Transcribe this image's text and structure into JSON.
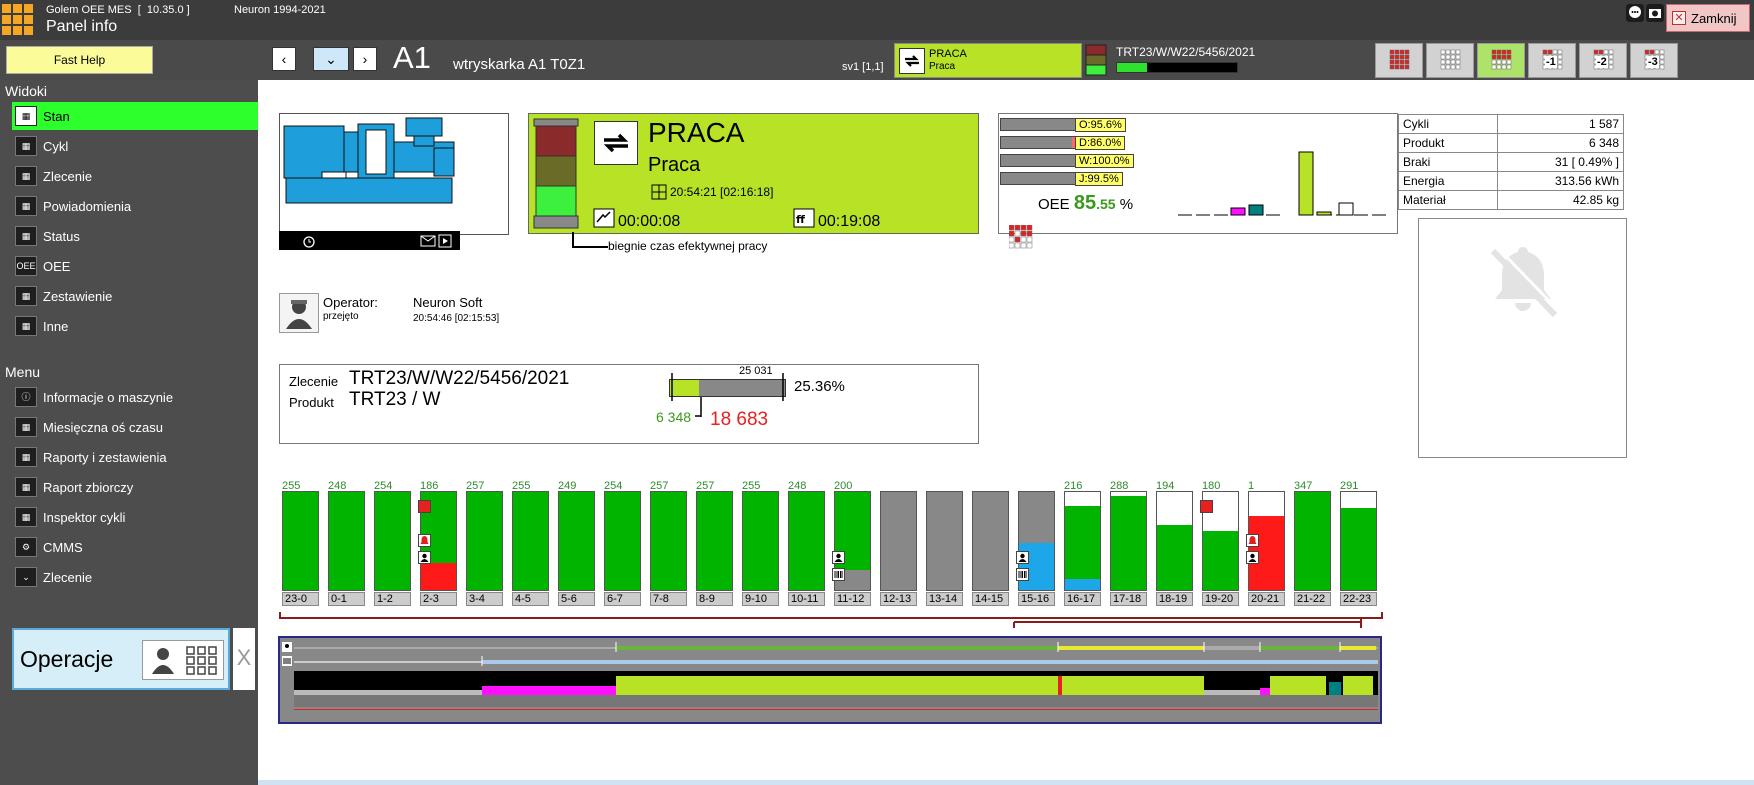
{
  "app": {
    "name": "Golem OEE MES  [  10.35.0 ]",
    "panel_title": "Panel info",
    "copyright": "Neuron 1994-2021",
    "close_label": "Zamknij"
  },
  "toolbar": {
    "fast_help": "Fast Help",
    "machine_id": "A1",
    "machine_desc": "wtryskarka A1  T0Z1",
    "sv": "sv1  [1,1]",
    "status_title": "PRACA",
    "status_sub": "Praca",
    "order_number": "TRT23/W/W22/5456/2021",
    "order_progress": 0.25,
    "view_buttons": [
      "",
      "",
      "",
      "-1",
      "-2",
      "-3"
    ]
  },
  "sidebar": {
    "views_header": "Widoki",
    "views": [
      {
        "label": "Stan",
        "icon": "machine-icon"
      },
      {
        "label": "Cykl",
        "icon": "cycle-icon"
      },
      {
        "label": "Zlecenie",
        "icon": "barcode-icon"
      },
      {
        "label": "Powiadomienia",
        "icon": "notification-icon"
      },
      {
        "label": "Status",
        "icon": "traffic-light-icon"
      },
      {
        "label": "OEE",
        "icon": "oee-icon"
      },
      {
        "label": "Zestawienie",
        "icon": "summary-icon"
      },
      {
        "label": "Inne",
        "icon": "flask-icon"
      }
    ],
    "menu_header": "Menu",
    "menu": [
      {
        "label": "Informacje o maszynie",
        "icon": "info-icon"
      },
      {
        "label": "Miesięczna oś czasu",
        "icon": "calendar-icon"
      },
      {
        "label": "Raporty i zestawienia",
        "icon": "report-icon"
      },
      {
        "label": "Raport zbiorczy",
        "icon": "summary-report-icon"
      },
      {
        "label": "Inspektor cykli",
        "icon": "inspector-icon"
      },
      {
        "label": "CMMS",
        "icon": "gear-icon"
      },
      {
        "label": "Zlecenie",
        "icon": "chevron-down-icon"
      }
    ],
    "operations_label": "Operacje",
    "operations_close": "X"
  },
  "status": {
    "title": "PRACA",
    "subtitle": "Praca",
    "time": "20:54:21   [02:16:18]",
    "run_time": "00:00:08",
    "stop_time": "00:19:08",
    "note": "biegnie czas efektywnej pracy"
  },
  "oee": {
    "bars": [
      {
        "label": "O:95.6%",
        "fraction": 0.956
      },
      {
        "label": "D:86.0%",
        "fraction": 0.86
      },
      {
        "label": "W:100.0%",
        "fraction": 1.0
      },
      {
        "label": "J:99.5%",
        "fraction": 0.995
      }
    ],
    "prefix": "OEE",
    "int": "85",
    "dec": ".55",
    "unit": "%"
  },
  "stats": [
    {
      "label": "Cykli",
      "value": "1 587"
    },
    {
      "label": "Produkt",
      "value": "6 348"
    },
    {
      "label": "Braki",
      "value": "31 [ 0.49% ]"
    },
    {
      "label": "Energia",
      "value": "313.56 kWh"
    },
    {
      "label": "Materiał",
      "value": "42.85 kg"
    }
  ],
  "operator": {
    "label": "Operator:",
    "sub": "przejęto",
    "name": "Neuron Soft",
    "time": "20:54:46  [02:15:53]"
  },
  "order": {
    "order_label": "Zlecenie",
    "product_label": "Produkt",
    "order_value": "TRT23/W/W22/5456/2021",
    "product_value": "TRT23 / W",
    "total": "25 031",
    "percent": "25.36%",
    "done": "6 348",
    "remaining": "18 683",
    "progress": 0.2536
  },
  "hours": [
    {
      "label": "23-0",
      "value": "255",
      "green": 1.0,
      "red": 0,
      "gray": 0,
      "blue": 0
    },
    {
      "label": "0-1",
      "value": "248",
      "green": 1.0,
      "red": 0,
      "gray": 0,
      "blue": 0
    },
    {
      "label": "1-2",
      "value": "254",
      "green": 1.0,
      "red": 0,
      "gray": 0,
      "blue": 0
    },
    {
      "label": "2-3",
      "value": "186",
      "green": 0.72,
      "red": 0.28,
      "gray": 0,
      "blue": 0
    },
    {
      "label": "3-4",
      "value": "257",
      "green": 1.0,
      "red": 0,
      "gray": 0,
      "blue": 0
    },
    {
      "label": "4-5",
      "value": "255",
      "green": 1.0,
      "red": 0,
      "gray": 0,
      "blue": 0
    },
    {
      "label": "5-6",
      "value": "249",
      "green": 1.0,
      "red": 0,
      "gray": 0,
      "blue": 0
    },
    {
      "label": "6-7",
      "value": "254",
      "green": 1.0,
      "red": 0,
      "gray": 0,
      "blue": 0
    },
    {
      "label": "7-8",
      "value": "257",
      "green": 1.0,
      "red": 0,
      "gray": 0,
      "blue": 0
    },
    {
      "label": "8-9",
      "value": "257",
      "green": 1.0,
      "red": 0,
      "gray": 0,
      "blue": 0
    },
    {
      "label": "9-10",
      "value": "255",
      "green": 1.0,
      "red": 0,
      "gray": 0,
      "blue": 0
    },
    {
      "label": "10-11",
      "value": "248",
      "green": 1.0,
      "red": 0,
      "gray": 0,
      "blue": 0
    },
    {
      "label": "11-12",
      "value": "200",
      "green": 0.8,
      "red": 0,
      "gray": 0.2,
      "blue": 0
    },
    {
      "label": "12-13",
      "value": "",
      "green": 0,
      "red": 0,
      "gray": 1.0,
      "blue": 0
    },
    {
      "label": "13-14",
      "value": "",
      "green": 0,
      "red": 0,
      "gray": 1.0,
      "blue": 0
    },
    {
      "label": "14-15",
      "value": "",
      "green": 0,
      "red": 0,
      "gray": 1.0,
      "blue": 0
    },
    {
      "label": "15-16",
      "value": "",
      "green": 0,
      "red": 0,
      "gray": 0.52,
      "blue": 0.48
    },
    {
      "label": "16-17",
      "value": "216",
      "green": 0.74,
      "red": 0,
      "gray": 0,
      "blue": 0.11
    },
    {
      "label": "17-18",
      "value": "288",
      "green": 0.96,
      "red": 0,
      "gray": 0,
      "blue": 0
    },
    {
      "label": "18-19",
      "value": "194",
      "green": 0.66,
      "red": 0,
      "gray": 0,
      "blue": 0
    },
    {
      "label": "19-20",
      "value": "180",
      "green": 0.6,
      "red": 0,
      "gray": 0,
      "blue": 0
    },
    {
      "label": "20-21",
      "value": "1",
      "green": 0,
      "red": 0.76,
      "gray": 0,
      "blue": 0
    },
    {
      "label": "21-22",
      "value": "347",
      "green": 1.0,
      "red": 0,
      "gray": 0,
      "blue": 0
    },
    {
      "label": "22-23",
      "value": "291",
      "green": 0.84,
      "red": 0,
      "gray": 0,
      "blue": 0
    }
  ],
  "colors": {
    "green": "#00b400",
    "red": "#ff1a1a",
    "gray": "#888888",
    "blue": "#1ea7e8",
    "lime": "#b7e226",
    "magenta": "#ff10ff",
    "teal": "#008080"
  }
}
